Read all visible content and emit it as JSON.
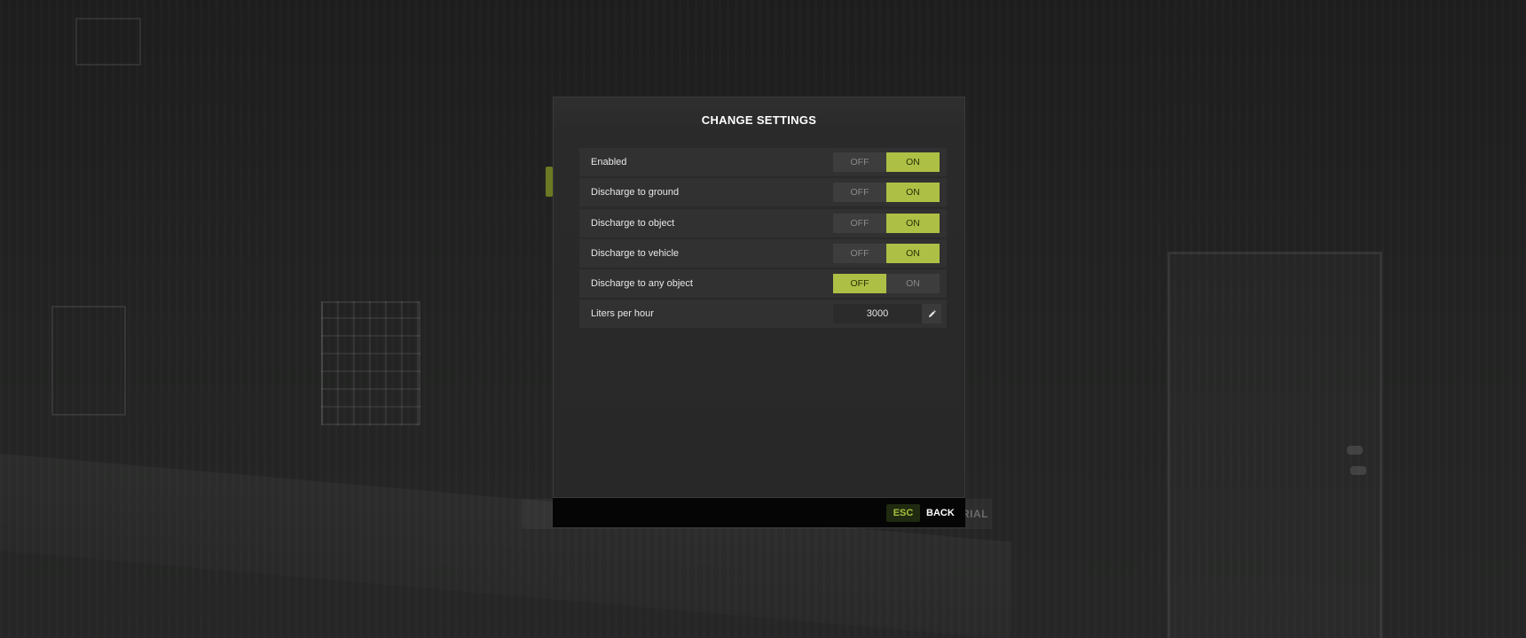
{
  "background": {
    "ghost_text": "RIAL"
  },
  "modal": {
    "title": "CHANGE SETTINGS",
    "settings": [
      {
        "label": "Enabled",
        "type": "toggle",
        "off_label": "OFF",
        "on_label": "ON",
        "value": "ON"
      },
      {
        "label": "Discharge to ground",
        "type": "toggle",
        "off_label": "OFF",
        "on_label": "ON",
        "value": "ON"
      },
      {
        "label": "Discharge to object",
        "type": "toggle",
        "off_label": "OFF",
        "on_label": "ON",
        "value": "ON"
      },
      {
        "label": "Discharge to vehicle",
        "type": "toggle",
        "off_label": "OFF",
        "on_label": "ON",
        "value": "ON"
      },
      {
        "label": "Discharge to any object",
        "type": "toggle",
        "off_label": "OFF",
        "on_label": "ON",
        "value": "OFF"
      },
      {
        "label": "Liters per hour",
        "type": "number",
        "value": "3000",
        "edit_icon": "pencil-icon"
      }
    ]
  },
  "footer": {
    "esc_key": "ESC",
    "back_label": "BACK"
  },
  "colors": {
    "accent": "#aebf45",
    "accent_text": "#2c3308",
    "esc_key_bg": "#1f2a10",
    "esc_key_text": "#a7c13d"
  }
}
